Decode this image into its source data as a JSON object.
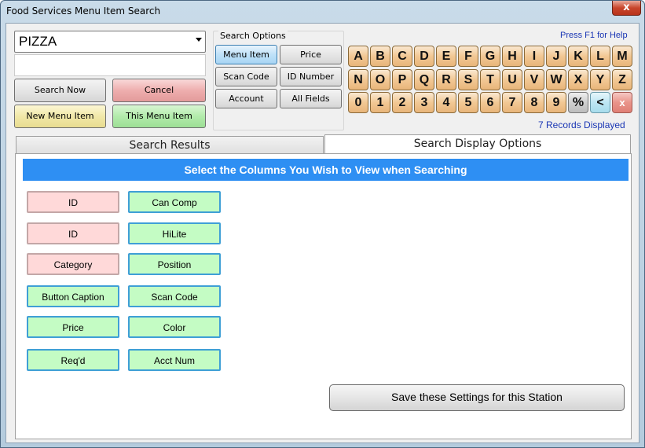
{
  "window": {
    "title": "Food Services Menu Item Search",
    "close_label": "x"
  },
  "search": {
    "combo_value": "PIZZA",
    "text_value": ""
  },
  "actions": {
    "search_now": "Search Now",
    "cancel": "Cancel",
    "new_menu_item": "New Menu Item",
    "this_menu_item": "This Menu Item"
  },
  "search_options": {
    "label": "Search Options",
    "buttons": [
      "Menu Item",
      "Price",
      "Scan Code",
      "ID Number",
      "Account",
      "All Fields"
    ],
    "selected": "Menu Item"
  },
  "help": "Press F1 for Help",
  "keyboard": {
    "row1": [
      "A",
      "B",
      "C",
      "D",
      "E",
      "F",
      "G",
      "H",
      "I",
      "J",
      "K",
      "L",
      "M"
    ],
    "row2": [
      "N",
      "O",
      "P",
      "Q",
      "R",
      "S",
      "T",
      "U",
      "V",
      "W",
      "X",
      "Y",
      "Z"
    ],
    "row3": [
      "0",
      "1",
      "2",
      "3",
      "4",
      "5",
      "6",
      "7",
      "8",
      "9",
      "%",
      "<",
      "x"
    ]
  },
  "records_displayed": "7 Records Displayed",
  "tabs": [
    "Search Results",
    "Search Display Options"
  ],
  "active_tab": "Search Display Options",
  "panel": {
    "heading": "Select the Columns You Wish to View when Searching",
    "left_column": [
      {
        "label": "ID",
        "enabled": false
      },
      {
        "label": "ID",
        "enabled": false
      },
      {
        "label": "Category",
        "enabled": false
      },
      {
        "label": "Button Caption",
        "enabled": true
      },
      {
        "label": "Price",
        "enabled": true
      },
      {
        "label": "Req'd",
        "enabled": true
      }
    ],
    "right_column": [
      {
        "label": "Can Comp",
        "enabled": true
      },
      {
        "label": "HiLite",
        "enabled": true
      },
      {
        "label": "Position",
        "enabled": true
      },
      {
        "label": "Scan Code",
        "enabled": true
      },
      {
        "label": "Color",
        "enabled": true
      },
      {
        "label": "Acct Num",
        "enabled": true
      }
    ],
    "save_button": "Save these Settings for this Station"
  },
  "colors": {
    "accent_blue": "#2e8ff3",
    "link_blue": "#1a36b4",
    "enabled_col": "#c4fcc4",
    "disabled_col": "#ffd9d9"
  }
}
